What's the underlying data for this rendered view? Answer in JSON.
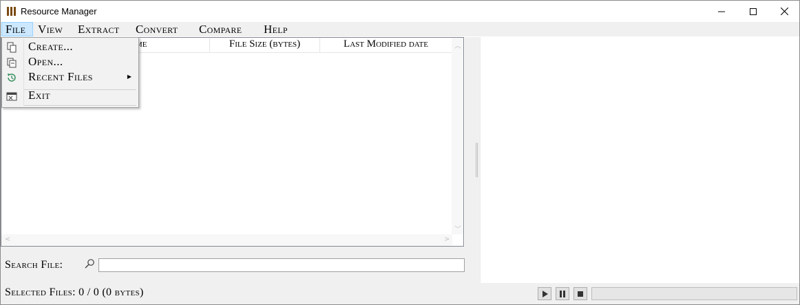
{
  "window": {
    "title": "Resource Manager"
  },
  "menubar": {
    "file": "File",
    "view": "View",
    "extract": "Extract",
    "convert": "Convert",
    "compare": "Compare",
    "help": "Help"
  },
  "file_menu": {
    "create": "Create...",
    "open": "Open...",
    "recent": "Recent Files",
    "exit": "Exit"
  },
  "list": {
    "columns": [
      "me",
      "File Size (bytes)",
      "Last Modified date"
    ]
  },
  "search": {
    "label": "Search File:",
    "value": "",
    "placeholder": ""
  },
  "status": {
    "selected": "Selected Files: 0 / 0 (0 bytes)",
    "progress": 0
  },
  "colors": {
    "menu_highlight": "#cce8ff",
    "accent_icon": "#7a4a12",
    "history_icon": "#2e8b57"
  }
}
